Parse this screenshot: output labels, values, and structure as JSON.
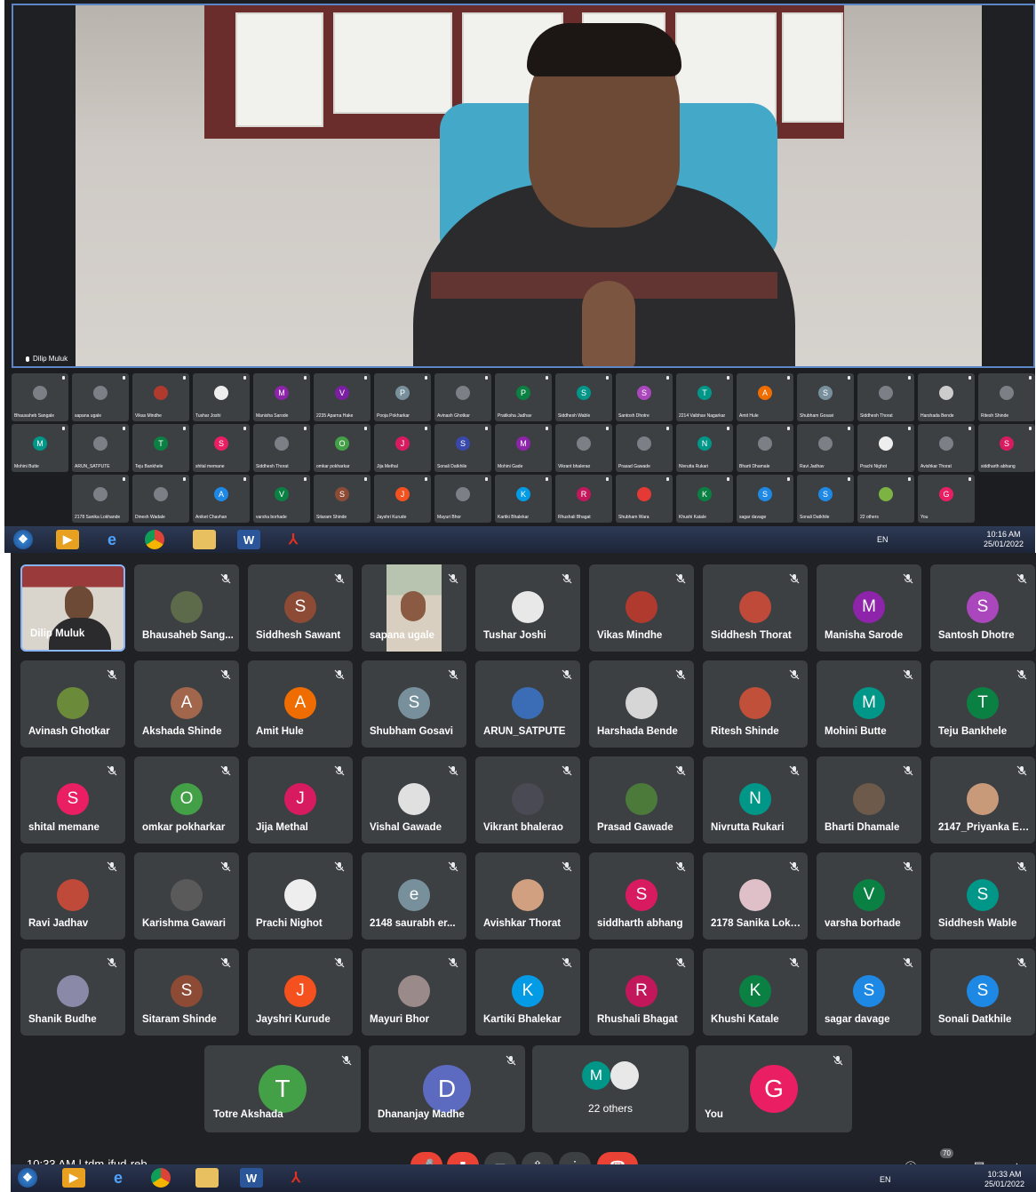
{
  "top": {
    "speaker_name": "Dilip Muluk",
    "strip_rows": [
      [
        {
          "name": "Bhausaheb Sangale",
          "color": "#7c7f86",
          "letter": "",
          "photo": true
        },
        {
          "name": "sapana ugale",
          "color": "#7c7f86",
          "letter": "",
          "photo": true
        },
        {
          "name": "Vikas Mindhe",
          "color": "#b03a2e",
          "letter": "",
          "photo": true
        },
        {
          "name": "Tushar Joshi",
          "color": "#eee",
          "letter": "",
          "photo": true
        },
        {
          "name": "Manisha Sarode",
          "color": "#8e24aa",
          "letter": "M"
        },
        {
          "name": "2235 Aparna Hake",
          "color": "#7b1fa2",
          "letter": "V"
        },
        {
          "name": "Pooja Pokharkar",
          "color": "#78909c",
          "letter": "P"
        },
        {
          "name": "Avinash Ghotkar",
          "color": "#7c7f86",
          "letter": "",
          "photo": true
        },
        {
          "name": "Pratiksha Jadhav",
          "color": "#0b8043",
          "letter": "P"
        },
        {
          "name": "Siddhesh Wable",
          "color": "#009688",
          "letter": "S"
        },
        {
          "name": "Santosh Dhotre",
          "color": "#ab47bc",
          "letter": "S"
        },
        {
          "name": "2214 Vaibhav Nagarkar",
          "color": "#009688",
          "letter": "T"
        },
        {
          "name": "Amit Hule",
          "color": "#ef6c00",
          "letter": "A"
        },
        {
          "name": "Shubham Gosavi",
          "color": "#78909c",
          "letter": "S"
        },
        {
          "name": "Siddhesh Thorat",
          "color": "#7c7f86",
          "letter": "",
          "photo": true
        },
        {
          "name": "Harshada Bende",
          "color": "#ccc",
          "letter": "",
          "photo": true
        },
        {
          "name": "Ritesh Shinde",
          "color": "#7c7f86",
          "letter": "",
          "photo": true
        }
      ],
      [
        {
          "name": "Mohini Butte",
          "color": "#009688",
          "letter": "M"
        },
        {
          "name": "ARUN_SATPUTE",
          "color": "#7c7f86",
          "letter": "",
          "photo": true
        },
        {
          "name": "Teju Bankhele",
          "color": "#0b8043",
          "letter": "T"
        },
        {
          "name": "shital memane",
          "color": "#e91e63",
          "letter": "S"
        },
        {
          "name": "Siddhesh Thorat",
          "color": "#7c7f86",
          "letter": "",
          "photo": true
        },
        {
          "name": "omkar pokharkar",
          "color": "#43a047",
          "letter": "O"
        },
        {
          "name": "Jija Methal",
          "color": "#d81b60",
          "letter": "J"
        },
        {
          "name": "Sonali Datkhile",
          "color": "#3949ab",
          "letter": "S"
        },
        {
          "name": "Mohini Gade",
          "color": "#8e24aa",
          "letter": "M"
        },
        {
          "name": "Vikrant bhalerao",
          "color": "#7c7f86",
          "letter": "",
          "photo": true
        },
        {
          "name": "Prasad Gawade",
          "color": "#7c7f86",
          "letter": "",
          "photo": true
        },
        {
          "name": "Nivrutta Rukari",
          "color": "#009688",
          "letter": "N"
        },
        {
          "name": "Bharti Dhamale",
          "color": "#7c7f86",
          "letter": "",
          "photo": true
        },
        {
          "name": "Ravi Jadhav",
          "color": "#7c7f86",
          "letter": "",
          "photo": true
        },
        {
          "name": "Prachi Nighot",
          "color": "#eee",
          "letter": "",
          "photo": true
        },
        {
          "name": "Avishkar Thorat",
          "color": "#7c7f86",
          "letter": "",
          "photo": true
        },
        {
          "name": "siddharth abhang",
          "color": "#d81b60",
          "letter": "S"
        }
      ],
      [
        {
          "name": "2178 Sanika Lokhande",
          "color": "#7c7f86",
          "letter": "",
          "photo": true
        },
        {
          "name": "Dinesh Wadale",
          "color": "#7c7f86",
          "letter": "",
          "photo": true
        },
        {
          "name": "Aniket Chavhan",
          "color": "#1e88e5",
          "letter": "A"
        },
        {
          "name": "varsha borhade",
          "color": "#0b8043",
          "letter": "V"
        },
        {
          "name": "Sitaram Shinde",
          "color": "#8d4b35",
          "letter": "S"
        },
        {
          "name": "Jayshri Kurude",
          "color": "#f4511e",
          "letter": "J"
        },
        {
          "name": "Mayuri Bhor",
          "color": "#7c7f86",
          "letter": "",
          "photo": true
        },
        {
          "name": "Kartiki Bhalekar",
          "color": "#039be5",
          "letter": "K"
        },
        {
          "name": "Rhushali Bhagat",
          "color": "#c2185b",
          "letter": "R"
        },
        {
          "name": "Shubham Wara",
          "color": "#e53935",
          "letter": ""
        },
        {
          "name": "Khushi Katale",
          "color": "#0b8043",
          "letter": "K"
        },
        {
          "name": "sagar davage",
          "color": "#1e88e5",
          "letter": "S"
        },
        {
          "name": "Sonali Datkhile",
          "color": "#1e88e5",
          "letter": "S"
        },
        {
          "name": "22 others",
          "color": "#7cb342",
          "letter": "",
          "photo": true
        },
        {
          "name": "You",
          "color": "#e91e63",
          "letter": "G"
        }
      ]
    ],
    "tray_lang": "EN",
    "time": "10:16 AM",
    "date": "25/01/2022"
  },
  "grid": [
    [
      {
        "name": "Dilip Muluk",
        "type": "self-video"
      },
      {
        "name": "Bhausaheb Sang...",
        "photo": true,
        "color": "#5d6b4a"
      },
      {
        "name": "Siddhesh Sawant",
        "letter": "S",
        "color": "#8d4b35"
      },
      {
        "name": "sapana ugale",
        "type": "video"
      },
      {
        "name": "Tushar Joshi",
        "photo": true,
        "color": "#e8e8e8"
      },
      {
        "name": "Vikas Mindhe",
        "photo": true,
        "color": "#b03a2e"
      },
      {
        "name": "Siddhesh Thorat",
        "photo": true,
        "color": "#c04a3a"
      },
      {
        "name": "Manisha Sarode",
        "letter": "M",
        "color": "#8e24aa"
      },
      {
        "name": "Santosh Dhotre",
        "letter": "S",
        "color": "#ab47bc"
      }
    ],
    [
      {
        "name": "Avinash Ghotkar",
        "photo": true,
        "color": "#6b8a3a"
      },
      {
        "name": "Akshada Shinde",
        "letter": "A",
        "color": "#a1664c"
      },
      {
        "name": "Amit Hule",
        "letter": "A",
        "color": "#ef6c00"
      },
      {
        "name": "Shubham Gosavi",
        "letter": "S",
        "color": "#78909c"
      },
      {
        "name": "ARUN_SATPUTE",
        "photo": true,
        "color": "#3a6db5"
      },
      {
        "name": "Harshada Bende",
        "photo": true,
        "color": "#d6d6d6"
      },
      {
        "name": "Ritesh Shinde",
        "photo": true,
        "color": "#c0503a"
      },
      {
        "name": "Mohini Butte",
        "letter": "M",
        "color": "#009688"
      },
      {
        "name": "Teju Bankhele",
        "letter": "T",
        "color": "#0b8043"
      }
    ],
    [
      {
        "name": "shital memane",
        "letter": "S",
        "color": "#e91e63"
      },
      {
        "name": "omkar pokharkar",
        "letter": "O",
        "color": "#43a047"
      },
      {
        "name": "Jija Methal",
        "letter": "J",
        "color": "#d81b60"
      },
      {
        "name": "Vishal Gawade",
        "photo": true,
        "color": "#e0e0e0"
      },
      {
        "name": "Vikrant bhalerao",
        "photo": true,
        "color": "#4a4a55"
      },
      {
        "name": "Prasad Gawade",
        "photo": true,
        "color": "#4c7a3a"
      },
      {
        "name": "Nivrutta Rukari",
        "letter": "N",
        "color": "#009688"
      },
      {
        "name": "Bharti Dhamale",
        "photo": true,
        "color": "#6d5a4a"
      },
      {
        "name": "2147_Priyanka Er...",
        "photo": true,
        "color": "#c99a7a"
      }
    ],
    [
      {
        "name": "Ravi Jadhav",
        "photo": true,
        "color": "#c04a3a"
      },
      {
        "name": "Karishma Gawari",
        "photo": true,
        "color": "#5a5a5a"
      },
      {
        "name": "Prachi Nighot",
        "photo": true,
        "color": "#eeeeee"
      },
      {
        "name": "2148 saurabh er...",
        "letter": "e",
        "color": "#78909c"
      },
      {
        "name": "Avishkar Thorat",
        "photo": true,
        "color": "#d0a080"
      },
      {
        "name": "siddharth abhang",
        "letter": "S",
        "color": "#d81b60"
      },
      {
        "name": "2178 Sanika Lokh...",
        "photo": true,
        "color": "#e0c0c8"
      },
      {
        "name": "varsha borhade",
        "letter": "V",
        "color": "#0b8043"
      },
      {
        "name": "Siddhesh Wable",
        "letter": "S",
        "color": "#009688"
      }
    ],
    [
      {
        "name": "Shanik Budhe",
        "photo": true,
        "color": "#8a8aa8"
      },
      {
        "name": "Sitaram Shinde",
        "letter": "S",
        "color": "#8d4b35"
      },
      {
        "name": "Jayshri Kurude",
        "letter": "J",
        "color": "#f4511e"
      },
      {
        "name": "Mayuri Bhor",
        "photo": true,
        "color": "#9a8a8a"
      },
      {
        "name": "Kartiki Bhalekar",
        "letter": "K",
        "color": "#039be5"
      },
      {
        "name": "Rhushali Bhagat",
        "letter": "R",
        "color": "#c2185b"
      },
      {
        "name": "Khushi Katale",
        "letter": "K",
        "color": "#0b8043"
      },
      {
        "name": "sagar davage",
        "letter": "S",
        "color": "#1e88e5"
      },
      {
        "name": "Sonali Datkhile",
        "letter": "S",
        "color": "#1e88e5"
      }
    ]
  ],
  "last_row": [
    {
      "name": "Totre Akshada",
      "letter": "T",
      "color": "#43a047"
    },
    {
      "name": "Dhananjay Madhe",
      "letter": "D",
      "color": "#5c6bc0"
    },
    {
      "name": "22 others",
      "letter": "M",
      "color": "#009688",
      "others": true
    },
    {
      "name": "You",
      "letter": "G",
      "color": "#e91e63"
    }
  ],
  "bottom_bar": {
    "time_text": "10:33 AM | tdm-ifud-reb",
    "tray_lang": "EN",
    "time": "10:33 AM",
    "date": "25/01/2022",
    "participant_count": "70"
  },
  "icons": [
    "mic-off-icon",
    "camera-off-icon",
    "captions-icon",
    "present-icon",
    "more-options-icon",
    "hang-up-icon"
  ]
}
